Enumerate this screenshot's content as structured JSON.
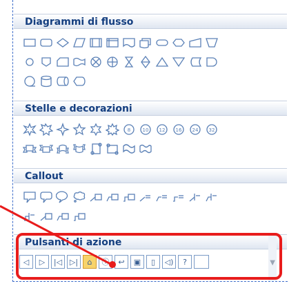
{
  "sections": [
    {
      "id": "flowchart",
      "label": "Diagrammi di flusso"
    },
    {
      "id": "stars",
      "label": "Stelle e decorazioni"
    },
    {
      "id": "callout",
      "label": "Callout"
    },
    {
      "id": "action",
      "label": "Pulsanti di azione"
    }
  ],
  "star_labels": [
    "8",
    "10",
    "12",
    "16",
    "24",
    "32"
  ],
  "action_buttons": [
    {
      "name": "action-back-button",
      "glyph": "◁"
    },
    {
      "name": "action-forward-button",
      "glyph": "▷"
    },
    {
      "name": "action-beginning-button",
      "glyph": "|◁"
    },
    {
      "name": "action-end-button",
      "glyph": "▷|"
    },
    {
      "name": "action-home-button",
      "glyph": "⌂"
    },
    {
      "name": "action-information-button",
      "glyph": "ⓘ"
    },
    {
      "name": "action-return-button",
      "glyph": "↩"
    },
    {
      "name": "action-movie-button",
      "glyph": "▣"
    },
    {
      "name": "action-document-button",
      "glyph": "▯"
    },
    {
      "name": "action-sound-button",
      "glyph": "◁)"
    },
    {
      "name": "action-help-button",
      "glyph": "?"
    },
    {
      "name": "action-custom-button",
      "glyph": ""
    }
  ],
  "selected_action": "action-home-button",
  "colors": {
    "accent": "#e81c1c",
    "header_text": "#153f80",
    "shape_stroke": "#5a80b6"
  }
}
